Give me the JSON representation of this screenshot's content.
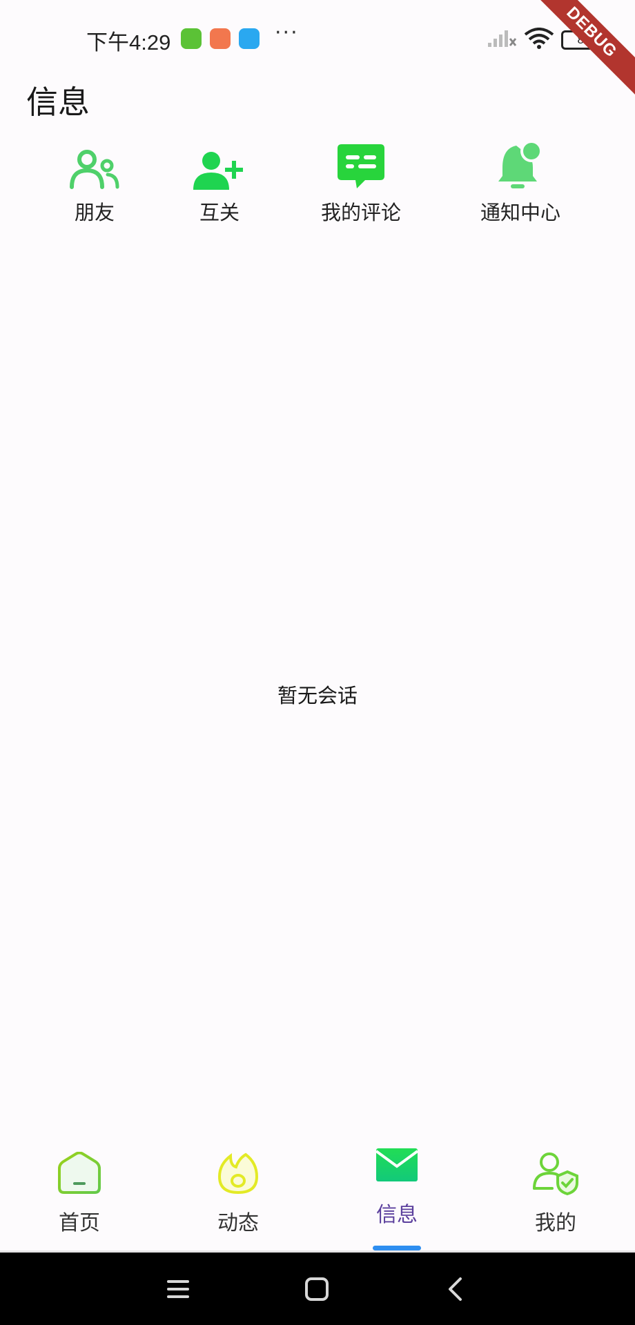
{
  "status_bar": {
    "time": "下午4:29",
    "battery": "84",
    "debug_label": "DEBUG"
  },
  "page": {
    "title": "信息"
  },
  "shortcuts": [
    {
      "label": "朋友",
      "icon": "friends-icon"
    },
    {
      "label": "互关",
      "icon": "add-follow-icon"
    },
    {
      "label": "我的评论",
      "icon": "comment-icon"
    },
    {
      "label": "通知中心",
      "icon": "notification-bell-icon"
    }
  ],
  "empty_state": {
    "text": "暂无会话"
  },
  "bottom_nav": {
    "items": [
      {
        "label": "首页",
        "icon": "home-icon"
      },
      {
        "label": "动态",
        "icon": "flame-icon"
      },
      {
        "label": "信息",
        "icon": "mail-icon",
        "active": true
      },
      {
        "label": "我的",
        "icon": "profile-shield-icon"
      }
    ]
  },
  "colors": {
    "accent_green": "#3ddc5a",
    "active_tab_text": "#5b3f9d",
    "indicator_blue": "#2e8ef0",
    "debug_red": "#b2352e"
  }
}
